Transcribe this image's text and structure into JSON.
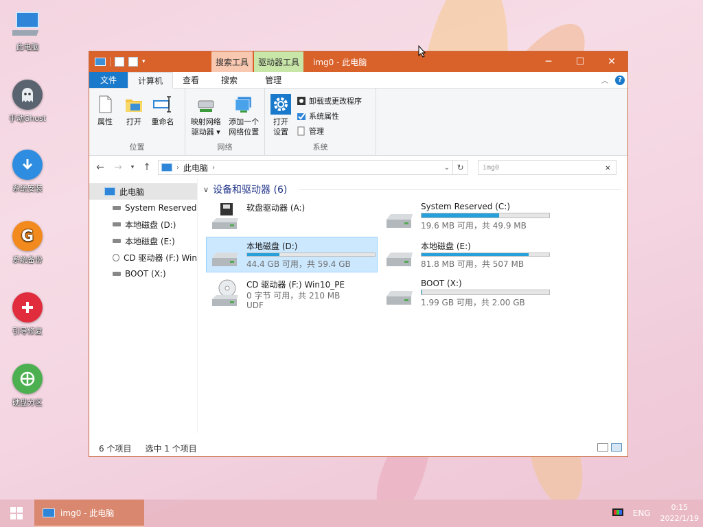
{
  "desktop": {
    "icons": [
      {
        "label": "此电脑",
        "icon": "computer-icon",
        "color": "#3d8fd6"
      },
      {
        "label": "手动Ghost",
        "icon": "ghost-icon",
        "color": "#5a6470"
      },
      {
        "label": "系统安装",
        "icon": "download-arrow-icon",
        "color": "#2e8de0"
      },
      {
        "label": "系统备份",
        "icon": "g-letter-icon",
        "color": "#f28a1d"
      },
      {
        "label": "引导修复",
        "icon": "plus-icon",
        "color": "#e02c3c"
      },
      {
        "label": "硬盘分区",
        "icon": "partition-icon",
        "color": "#4caf50"
      }
    ]
  },
  "window": {
    "title": "img0 - 此电脑",
    "context_tabs": {
      "search_tools": "搜索工具",
      "drive_tools": "驱动器工具"
    },
    "ribbon_tabs": {
      "file": "文件",
      "computer": "计算机",
      "view": "查看",
      "search": "搜索",
      "manage": "管理"
    },
    "ribbon": {
      "location": {
        "name": "位置",
        "properties": "属性",
        "open": "打开",
        "rename": "重命名"
      },
      "network": {
        "name": "网络",
        "map_drive": "映射网络\n驱动器 ▾",
        "add_location": "添加一个\n网络位置"
      },
      "system": {
        "name": "系统",
        "open_settings": "打开\n设置",
        "uninstall": "卸载或更改程序",
        "sys_props": "系统属性",
        "manage": "管理"
      }
    },
    "address": {
      "path": "此电脑"
    },
    "search": {
      "value": "img0"
    },
    "navpane": {
      "root": "此电脑",
      "items": [
        "System Reserved",
        "本地磁盘 (D:)",
        "本地磁盘 (E:)",
        "CD 驱动器 (F:) Win",
        "BOOT (X:)"
      ]
    },
    "group_header": "设备和驱动器 (6)",
    "drives": [
      {
        "name": "软盘驱动器 (A:)",
        "type": "floppy",
        "sub": "",
        "used_fraction": null,
        "extra": ""
      },
      {
        "name": "System Reserved (C:)",
        "type": "hdd",
        "sub": "19.6 MB 可用，共 49.9 MB",
        "used_fraction": 0.61,
        "extra": ""
      },
      {
        "name": "本地磁盘 (D:)",
        "type": "hdd",
        "sub": "44.4 GB 可用，共 59.4 GB",
        "used_fraction": 0.25,
        "extra": "",
        "selected": true
      },
      {
        "name": "本地磁盘 (E:)",
        "type": "hdd",
        "sub": "81.8 MB 可用，共 507 MB",
        "used_fraction": 0.84,
        "extra": ""
      },
      {
        "name": "CD 驱动器 (F:) Win10_PE",
        "type": "cd",
        "sub": "0 字节 可用，共 210 MB",
        "used_fraction": null,
        "extra": "UDF"
      },
      {
        "name": "BOOT (X:)",
        "type": "hdd",
        "sub": "1.99 GB 可用，共 2.00 GB",
        "used_fraction": 0.005,
        "extra": ""
      }
    ],
    "status": {
      "count": "6 个项目",
      "selected": "选中 1 个项目"
    }
  },
  "taskbar": {
    "task": "img0 - 此电脑",
    "lang": "ENG",
    "time": "0:15",
    "date": "2022/1/19"
  },
  "colors": {
    "titlebar": "#d9622b",
    "accent": "#1979ca",
    "bar_fill": "#26a0da",
    "selection": "#cce8ff"
  }
}
